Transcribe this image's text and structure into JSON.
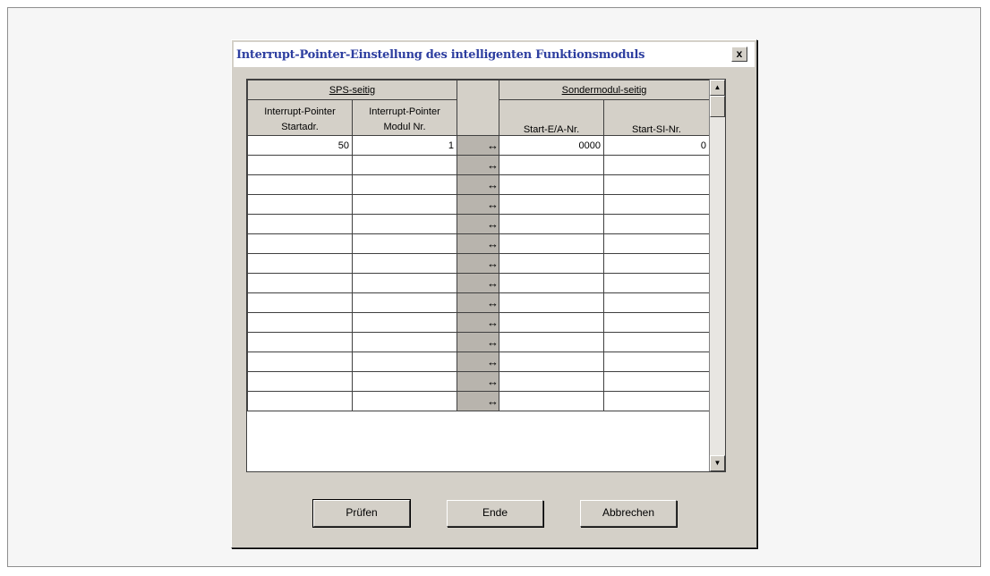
{
  "dialog": {
    "title": "Interrupt-Pointer-Einstellung des intelligenten Funktionsmoduls",
    "close_label": "x"
  },
  "grid": {
    "left_group": "SPS-seitig",
    "right_group": "Sondermodul-seitig",
    "columns": [
      {
        "line1": "Interrupt-Pointer",
        "line2": "Startadr."
      },
      {
        "line1": "Interrupt-Pointer",
        "line2": "Modul Nr."
      },
      {
        "line1": "",
        "line2": "Start-E/A-Nr."
      },
      {
        "line1": "",
        "line2": "Start-SI-Nr."
      }
    ],
    "arrow_glyph": "↔",
    "rows": [
      [
        "50",
        "1",
        "0000",
        "0"
      ],
      [
        "",
        "",
        "",
        ""
      ],
      [
        "",
        "",
        "",
        ""
      ],
      [
        "",
        "",
        "",
        ""
      ],
      [
        "",
        "",
        "",
        ""
      ],
      [
        "",
        "",
        "",
        ""
      ],
      [
        "",
        "",
        "",
        ""
      ],
      [
        "",
        "",
        "",
        ""
      ],
      [
        "",
        "",
        "",
        ""
      ],
      [
        "",
        "",
        "",
        ""
      ],
      [
        "",
        "",
        "",
        ""
      ],
      [
        "",
        "",
        "",
        ""
      ],
      [
        "",
        "",
        "",
        ""
      ],
      [
        "",
        "",
        "",
        ""
      ]
    ]
  },
  "scrollbar": {
    "up_icon": "scroll-up-arrow",
    "down_icon": "scroll-down-arrow"
  },
  "buttons": {
    "check": "Prüfen",
    "end": "Ende",
    "cancel": "Abbrechen"
  }
}
